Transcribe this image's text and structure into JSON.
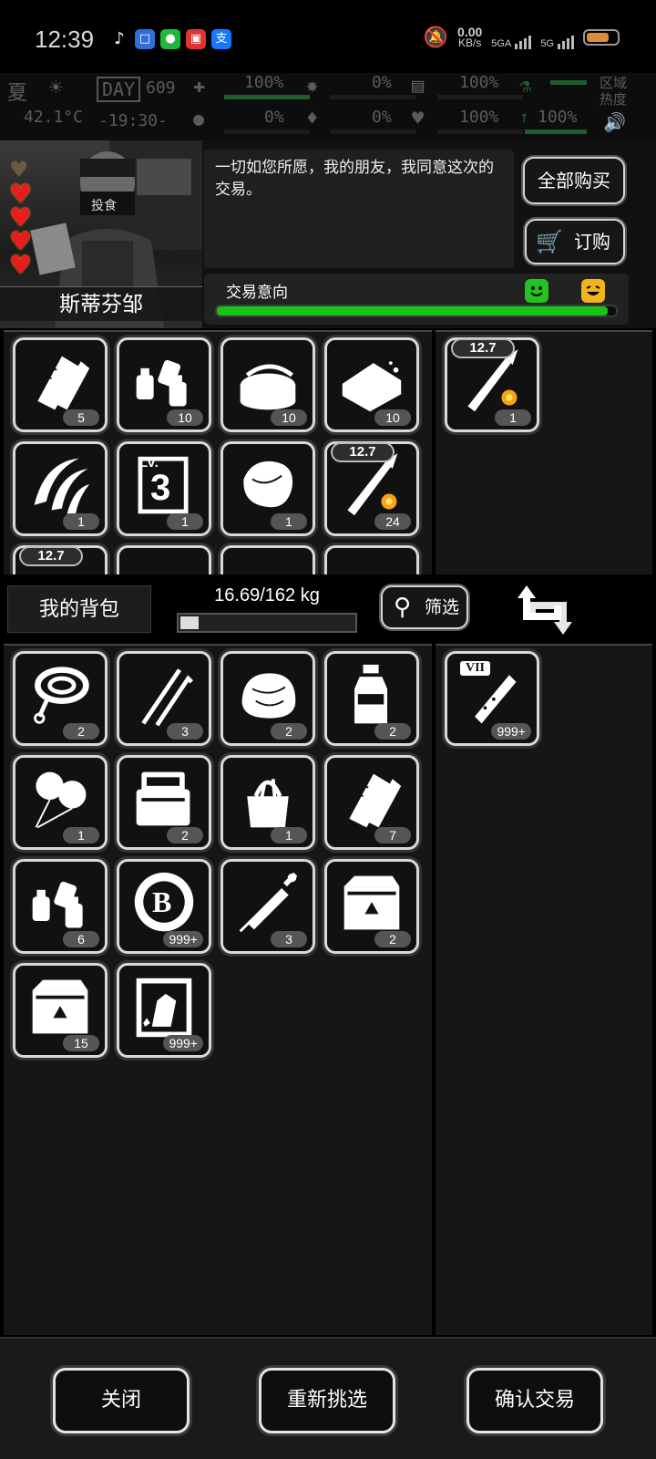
{
  "status_bar": {
    "time": "12:39",
    "net_speed": "0.00",
    "net_unit": "KB/s",
    "sig1": "5GA",
    "sig2": "5G",
    "app_icons": [
      "tiktok-icon",
      "app-icon",
      "wechat-icon",
      "app-icon",
      "alipay-icon"
    ]
  },
  "hud": {
    "season": "夏",
    "day_label": "DAY",
    "day": "609",
    "temperature": "42.1°C",
    "clock": "-19:30-",
    "stat_values": [
      "100%",
      "0%",
      "0%",
      "0%",
      "100%",
      "100%",
      "100%"
    ],
    "region_label_1": "区域",
    "region_label_2": "热度"
  },
  "trader": {
    "name": "斯蒂芬邹",
    "dialogue": "一切如您所愿，我的朋友，我同意这次的交易。",
    "buy_all": "全部购买",
    "order": "订购",
    "intent_label": "交易意向",
    "intent_level": 0.98,
    "hearts": 5
  },
  "trader_items": [
    {
      "icon": "bandage-icon",
      "count": "5"
    },
    {
      "icon": "bottles-icon",
      "count": "10"
    },
    {
      "icon": "canned-food-icon",
      "count": "10"
    },
    {
      "icon": "bread-icon",
      "count": "10"
    },
    {
      "icon": "claw-icon",
      "count": "1"
    },
    {
      "icon": "level-book-icon",
      "count": "1",
      "level": "3",
      "level_prefix": "LV."
    },
    {
      "icon": "meat-icon",
      "count": "1"
    },
    {
      "icon": "bullet-icon",
      "count": "24",
      "caliber": "12.7"
    }
  ],
  "trade_offer": [
    {
      "icon": "bullet-icon",
      "count": "1",
      "caliber": "12.7"
    }
  ],
  "partial_row": {
    "caliber": "12.7"
  },
  "backpack": {
    "title": "我的背包",
    "weight": "16.69/162 kg",
    "weight_fraction": 0.103,
    "filter": "筛选",
    "items": [
      {
        "icon": "rope-icon",
        "count": "2"
      },
      {
        "icon": "lockpick-icon",
        "count": "3"
      },
      {
        "icon": "raw-meat-icon",
        "count": "2"
      },
      {
        "icon": "water-bottle-icon",
        "count": "2"
      },
      {
        "icon": "balloon-icon",
        "count": "1"
      },
      {
        "icon": "toolbox-icon",
        "count": "2"
      },
      {
        "icon": "tool-bag-icon",
        "count": "1"
      },
      {
        "icon": "bandage-icon",
        "count": "7"
      },
      {
        "icon": "bottles-icon",
        "count": "6"
      },
      {
        "icon": "bitcoin-icon",
        "count": "999+",
        "letter": "B"
      },
      {
        "icon": "syringe-icon",
        "count": "3"
      },
      {
        "icon": "crate-icon",
        "count": "2"
      },
      {
        "icon": "crate-icon",
        "count": "15"
      },
      {
        "icon": "zombie-card-icon",
        "count": "999+"
      }
    ],
    "offered": [
      {
        "icon": "test-tube-icon",
        "count": "999+",
        "tier": "VII"
      }
    ]
  },
  "buttons": {
    "close": "关闭",
    "reselect": "重新挑选",
    "confirm": "确认交易"
  },
  "colors": {
    "intent_green": "#17c417",
    "heart_red": "#e81c1c"
  }
}
